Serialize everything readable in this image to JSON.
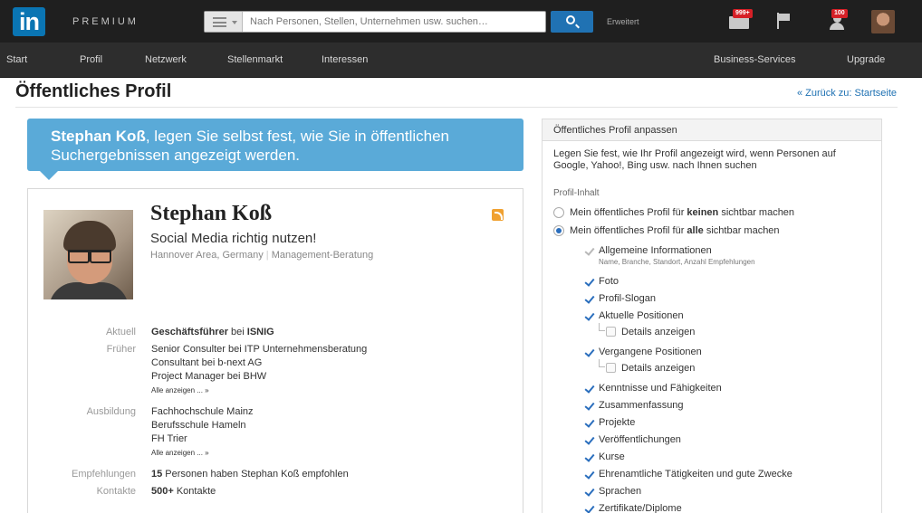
{
  "header": {
    "logo": "in",
    "premium": "PREMIUM",
    "search_placeholder": "Nach Personen, Stellen, Unternehmen usw. suchen…",
    "advanced": "Erweitert",
    "mail_badge": "999+",
    "notif_badge": "100"
  },
  "nav": {
    "items": [
      "Start",
      "Profil",
      "Netzwerk",
      "Stellenmarkt",
      "Interessen"
    ],
    "right_items": [
      "Business-Services",
      "Upgrade"
    ]
  },
  "page": {
    "title": "Öffentliches Profil",
    "back_link": "« Zurück zu: Startseite"
  },
  "callout": {
    "name": "Stephan Koß",
    "text": ", legen Sie selbst fest, wie Sie in öffentlichen Suchergebnissen angezeigt werden."
  },
  "profile": {
    "name": "Stephan Koß",
    "headline": "Social Media richtig nutzen!",
    "location": "Hannover Area, Germany",
    "separator": "|",
    "industry": "Management-Beratung",
    "rows": [
      {
        "label": "Aktuell",
        "values": [
          "Geschäftsführer bei ISNIG"
        ]
      },
      {
        "label": "Früher",
        "values": [
          "Senior Consulter bei ITP Unternehmensberatung",
          "Consultant bei b-next AG",
          "Project Manager bei BHW"
        ],
        "more": "Alle anzeigen ... »"
      },
      {
        "label": "Ausbildung",
        "values": [
          "Fachhochschule Mainz",
          "Berufsschule Hameln",
          "FH Trier"
        ],
        "more": "Alle anzeigen ... »"
      },
      {
        "label": "Empfehlungen",
        "values": [
          "15 Personen haben Stephan Koß empfohlen"
        ]
      },
      {
        "label": "Kontakte",
        "values": [
          "500+ Kontakte"
        ]
      }
    ]
  },
  "panel": {
    "title": "Öffentliches Profil anpassen",
    "description": "Legen Sie fest, wie Ihr Profil angezeigt wird, wenn Personen auf Google, Yahoo!, Bing usw. nach Ihnen suchen",
    "section_label": "Profil-Inhalt",
    "radio_none_pre": "Mein öffentliches Profil für ",
    "radio_none_bold": "keinen",
    "radio_none_post": " sichtbar machen",
    "radio_all_pre": "Mein öffentliches Profil für ",
    "radio_all_bold": "alle",
    "radio_all_post": " sichtbar machen",
    "general": "Allgemeine Informationen",
    "general_sub": "Name, Branche, Standort, Anzahl Empfehlungen",
    "items": [
      "Foto",
      "Profil-Slogan",
      "Aktuelle Positionen"
    ],
    "details1": "Details anzeigen",
    "past": "Vergangene Positionen",
    "details2": "Details anzeigen",
    "items2": [
      "Kenntnisse und Fähigkeiten",
      "Zusammenfassung",
      "Projekte",
      "Veröffentlichungen",
      "Kurse",
      "Ehrenamtliche Tätigkeiten und gute Zwecke",
      "Sprachen",
      "Zertifikate/Diplome"
    ]
  }
}
